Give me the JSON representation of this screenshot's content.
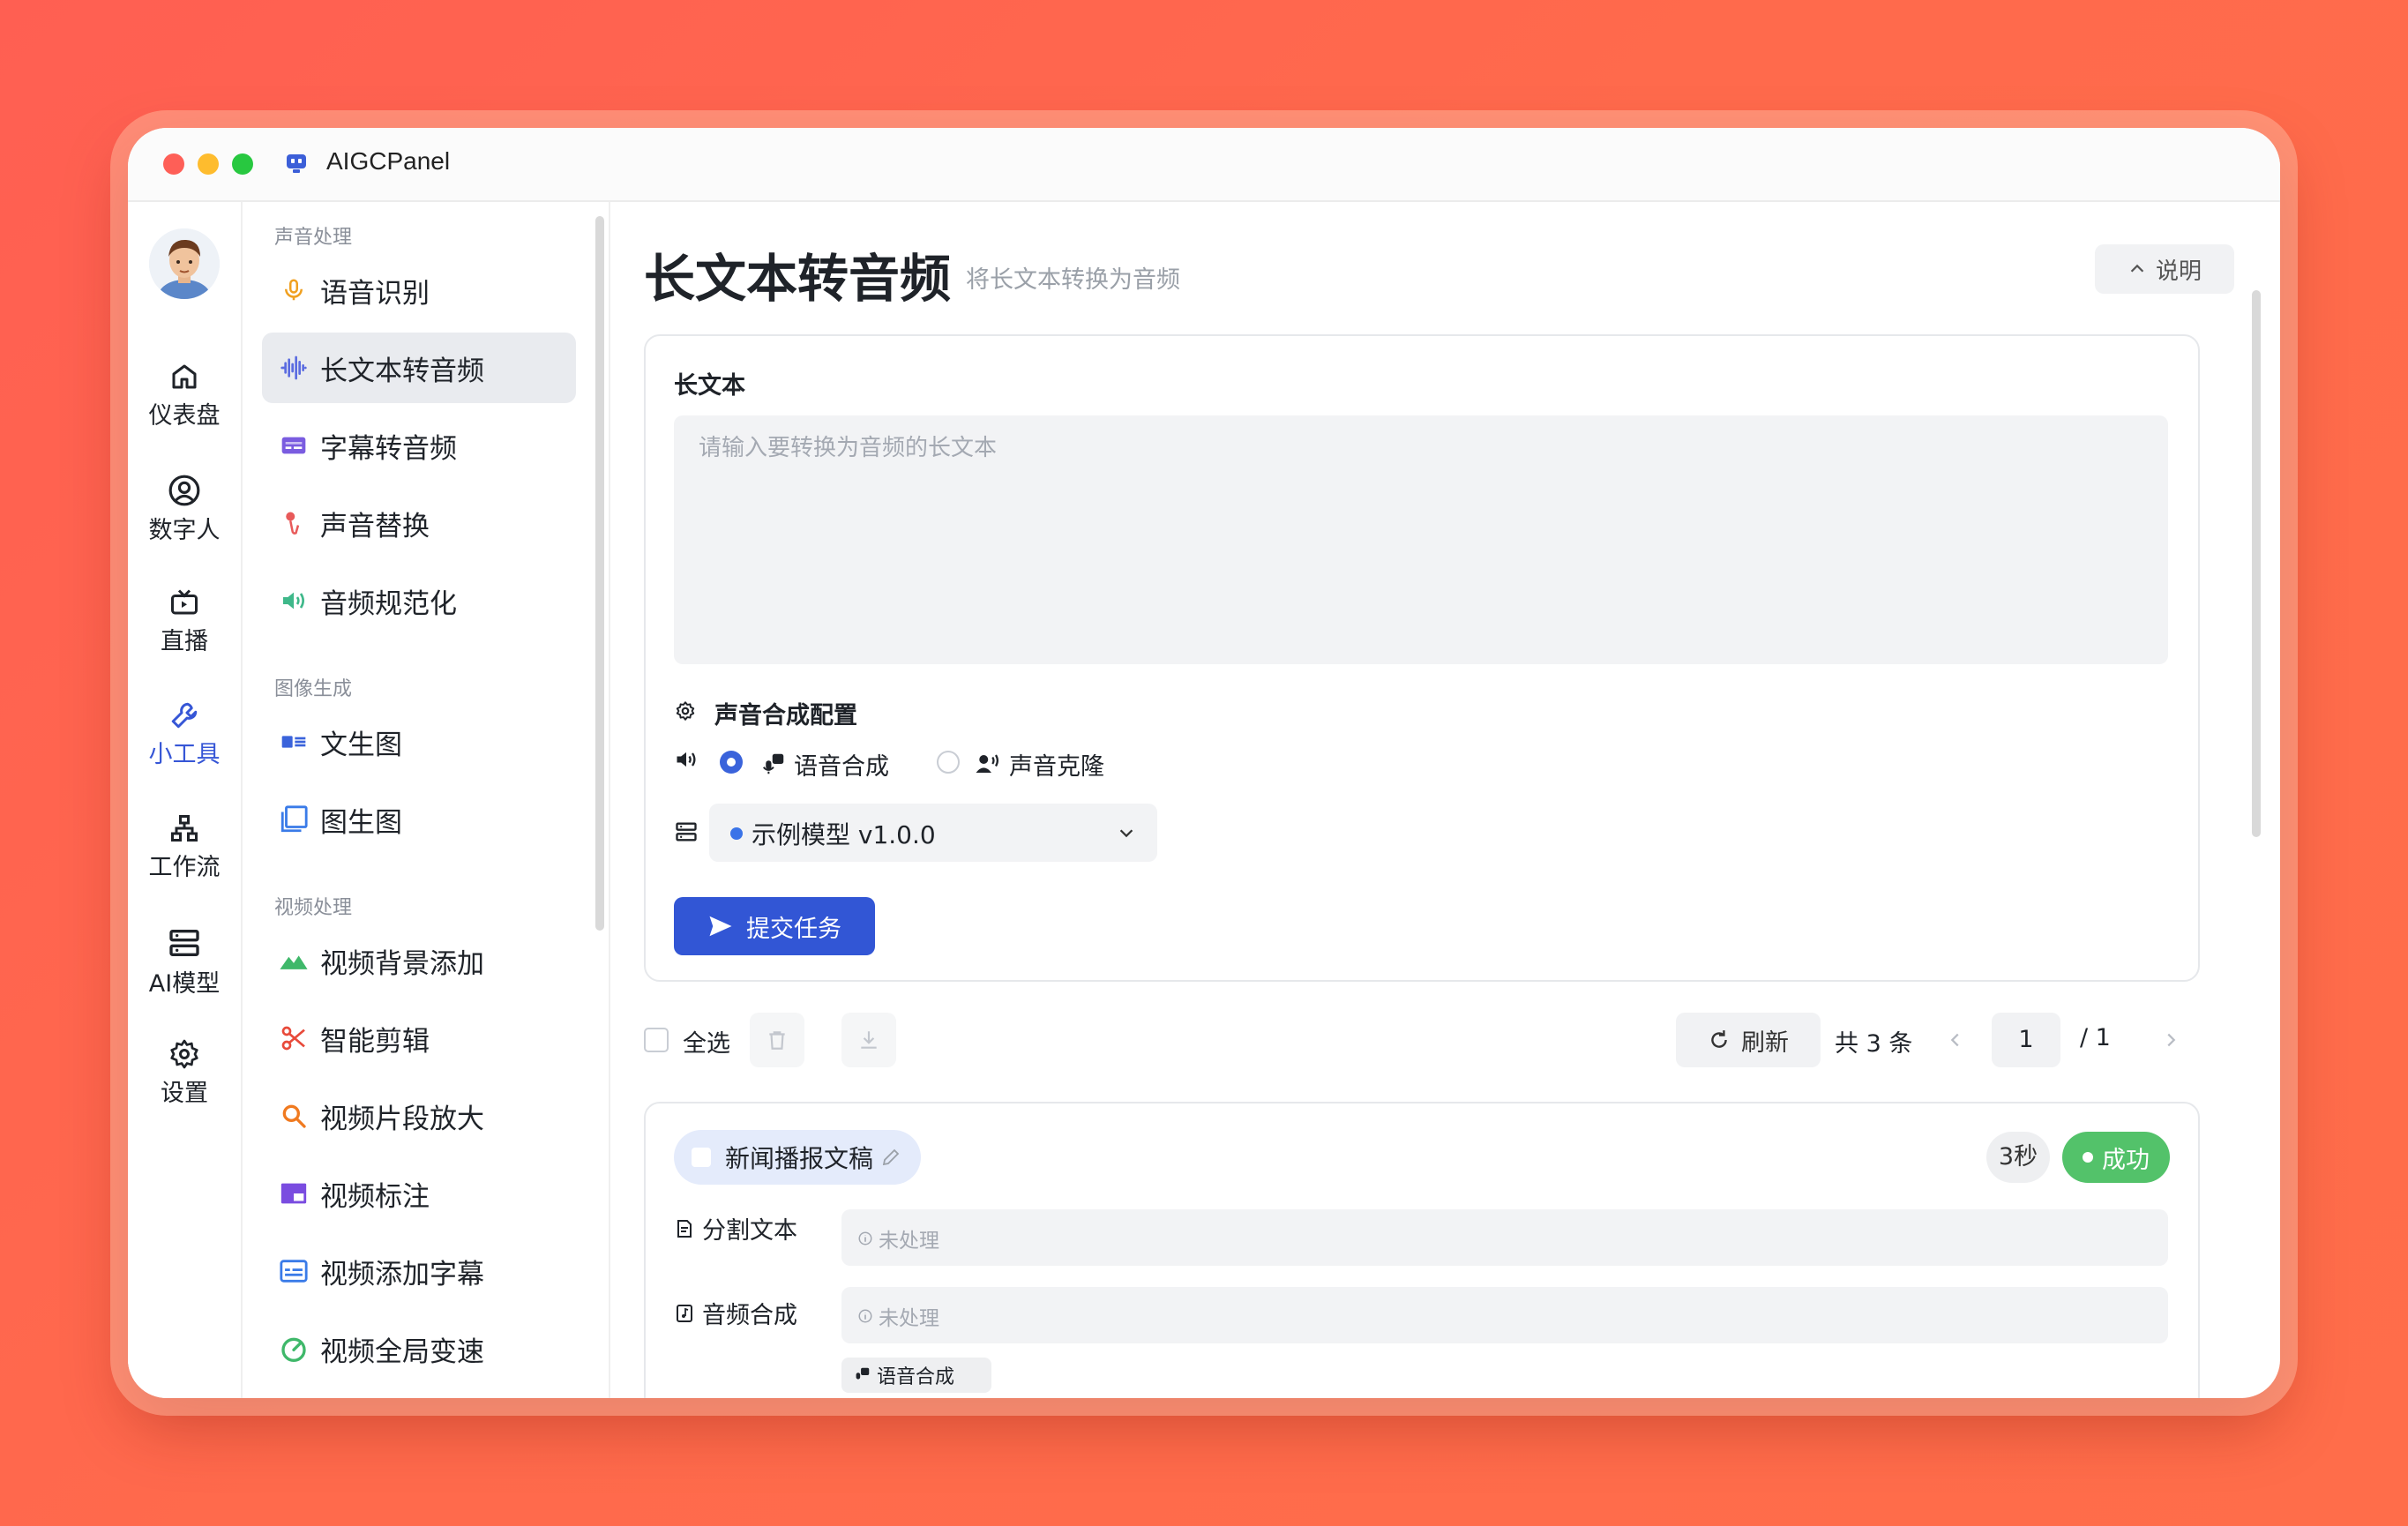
{
  "window": {
    "title": "AIGCPanel"
  },
  "rail": {
    "items": [
      {
        "label": "仪表盘",
        "icon": "home-icon"
      },
      {
        "label": "数字人",
        "icon": "user-circle-icon"
      },
      {
        "label": "直播",
        "icon": "tv-icon"
      },
      {
        "label": "小工具",
        "icon": "wrench-icon",
        "active": true
      },
      {
        "label": "工作流",
        "icon": "workflow-icon"
      },
      {
        "label": "AI模型",
        "icon": "server-icon"
      },
      {
        "label": "设置",
        "icon": "gear-icon"
      }
    ]
  },
  "submenu": {
    "sections": [
      {
        "label": "声音处理",
        "items": [
          "语音识别",
          "长文本转音频",
          "字幕转音频",
          "声音替换",
          "音频规范化"
        ]
      },
      {
        "label": "图像生成",
        "items": [
          "文生图",
          "图生图"
        ]
      },
      {
        "label": "视频处理",
        "items": [
          "视频背景添加",
          "智能剪辑",
          "视频片段放大",
          "视频标注",
          "视频添加字幕",
          "视频全局变速"
        ]
      }
    ],
    "active": "长文本转音频"
  },
  "page": {
    "title": "长文本转音频",
    "subtitle": "将长文本转换为音频",
    "help_label": "说明"
  },
  "form": {
    "text_label": "长文本",
    "text_placeholder": "请输入要转换为音频的长文本",
    "config_label": "声音合成配置",
    "mode_options": [
      {
        "label": "语音合成",
        "selected": true
      },
      {
        "label": "声音克隆",
        "selected": false
      }
    ],
    "model_select": "示例模型 v1.0.0",
    "submit_label": "提交任务"
  },
  "toolbar": {
    "select_all": "全选",
    "refresh": "刷新",
    "total": "共 3 条",
    "current_page": "1",
    "page_total": "/ 1"
  },
  "task": {
    "title": "新闻播报文稿",
    "duration": "3秒",
    "status": "成功",
    "rows": [
      {
        "label": "分割文本",
        "value": "未处理"
      },
      {
        "label": "音频合成",
        "value": "未处理"
      }
    ],
    "sub_tag": "语音合成"
  },
  "colors": {
    "accent": "#3256d5",
    "success": "#53c26a",
    "background": "#ff5f52"
  }
}
